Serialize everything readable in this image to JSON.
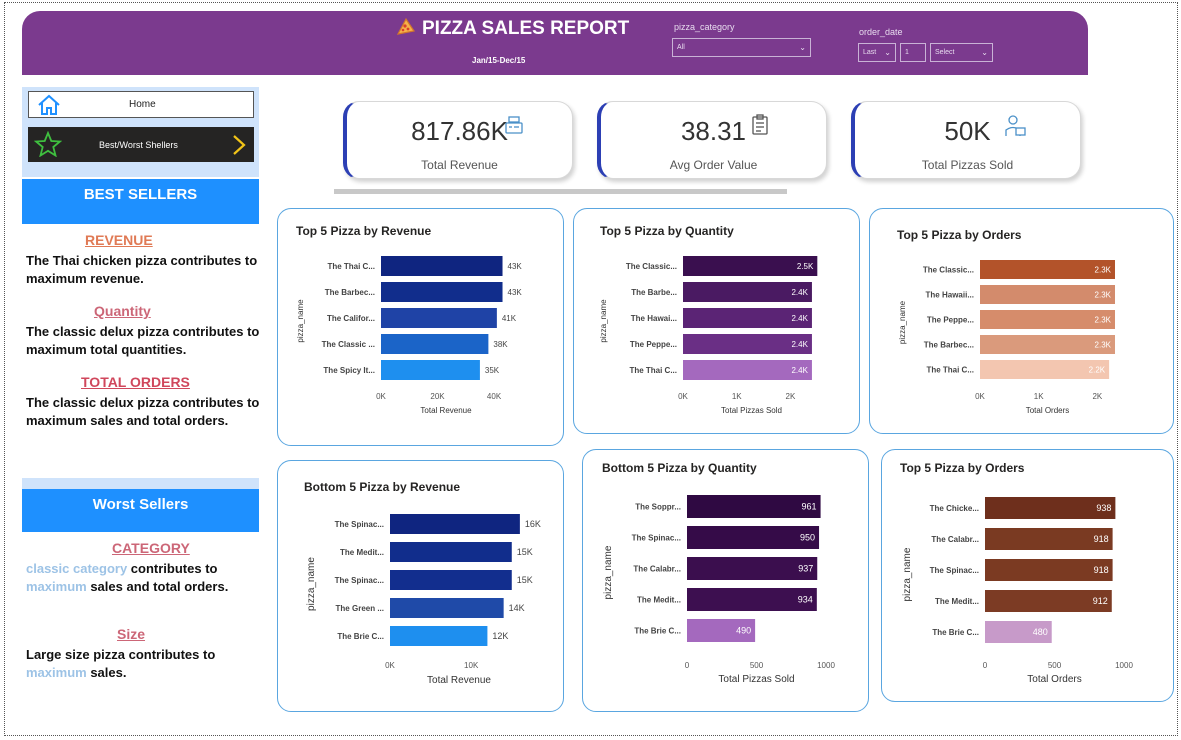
{
  "header": {
    "title": "PIZZA SALES REPORT",
    "subtitle": "Jan/15-Dec/15",
    "filters": {
      "category_label": "pizza_category",
      "category_value": "All",
      "date_label": "order_date",
      "date_mode": "Last",
      "date_count": "1",
      "date_unit": "Select"
    }
  },
  "nav": {
    "home_label": "Home",
    "bestworst_label": "Best/Worst Shellers"
  },
  "best": {
    "heading": "BEST SELLERS",
    "revenue_head": "REVENUE",
    "revenue_text": "The Thai chicken pizza contributes to maximum revenue.",
    "quantity_head": "Quantity",
    "quantity_text": "The classic delux pizza contributes to maximum total quantities.",
    "orders_head": "TOTAL ORDERS",
    "orders_text": "The classic delux pizza contributes to maximum sales and total orders."
  },
  "worst": {
    "heading": "Worst Sellers",
    "category_head": "CATEGORY",
    "category_hl1": "classic category",
    "category_t1": " contributes to",
    "category_hl2": "maximum",
    "category_t2": " sales and total orders.",
    "size_head": "Size",
    "size_t1": "Large size pizza contributes to",
    "size_hl": "maximum",
    "size_t2": " sales."
  },
  "kpis": [
    {
      "value": "817.86K",
      "label": "Total Revenue",
      "icon": "cash-register-icon"
    },
    {
      "value": "38.31",
      "label": "Avg Order Value",
      "icon": "clipboard-icon"
    },
    {
      "value": "50K",
      "label": "Total Pizzas Sold",
      "icon": "delivery-person-icon"
    }
  ],
  "colors": {
    "header": "#7b3a8e",
    "accent_blue": "#1e90ff",
    "kpi_border": "#2c3fb4"
  },
  "chart_data": [
    {
      "id": "top-revenue",
      "type": "bar",
      "title": "Top 5 Pizza by Revenue",
      "ylabel": "pizza_name",
      "xlabel": "Total Revenue",
      "categories": [
        "The Thai C...",
        "The Barbec...",
        "The Califor...",
        "The Classic ...",
        "The Spicy It..."
      ],
      "values": [
        43,
        43,
        41,
        38,
        35
      ],
      "labels": [
        "43K",
        "43K",
        "41K",
        "38K",
        "35K"
      ],
      "ticks": [
        0,
        20,
        40
      ],
      "tick_labels": [
        "0K",
        "20K",
        "40K"
      ],
      "xlim": [
        0,
        46
      ],
      "colors": [
        "#0f2580",
        "#112d8c",
        "#1f43a6",
        "#1b64c8",
        "#1e8fef"
      ]
    },
    {
      "id": "top-quantity",
      "type": "bar",
      "title": "Top 5 Pizza by Quantity",
      "ylabel": "pizza_name",
      "xlabel": "Total Pizzas Sold",
      "categories": [
        "The Classic...",
        "The Barbe...",
        "The Hawai...",
        "The Peppe...",
        "The Thai C..."
      ],
      "values": [
        2.5,
        2.4,
        2.4,
        2.4,
        2.4
      ],
      "labels": [
        "2.5K",
        "2.4K",
        "2.4K",
        "2.4K",
        "2.4K"
      ],
      "ticks": [
        0,
        1,
        2
      ],
      "tick_labels": [
        "0K",
        "1K",
        "2K"
      ],
      "xlim": [
        0,
        2.55
      ],
      "colors": [
        "#3a0f4f",
        "#4a1a62",
        "#5b2475",
        "#6a2f85",
        "#a469be"
      ]
    },
    {
      "id": "top-orders-1",
      "type": "bar",
      "title": "Top 5 Pizza by Orders",
      "ylabel": "pizza_name",
      "xlabel": "Total Orders",
      "categories": [
        "The Classic...",
        "The Hawaii...",
        "The Peppe...",
        "The Barbec...",
        "The Thai C..."
      ],
      "values": [
        2.3,
        2.3,
        2.3,
        2.3,
        2.2
      ],
      "labels": [
        "2.3K",
        "2.3K",
        "2.3K",
        "2.3K",
        "2.2K"
      ],
      "ticks": [
        0,
        1,
        2
      ],
      "tick_labels": [
        "0K",
        "1K",
        "2K"
      ],
      "xlim": [
        0,
        2.3
      ],
      "colors": [
        "#b3532a",
        "#d38b6c",
        "#d68c6b",
        "#da9a7c",
        "#f3c6b0"
      ]
    },
    {
      "id": "bottom-revenue",
      "type": "bar",
      "title": "Bottom 5 Pizza by Revenue",
      "ylabel": "pizza_name",
      "xlabel": "Total Revenue",
      "categories": [
        "The Spinac...",
        "The Medit...",
        "The Spinac...",
        "The Green ...",
        "The Brie C..."
      ],
      "values": [
        16,
        15,
        15,
        14,
        12
      ],
      "labels": [
        "16K",
        "15K",
        "15K",
        "14K",
        "12K"
      ],
      "ticks": [
        0,
        10
      ],
      "tick_labels": [
        "0K",
        "10K"
      ],
      "xlim": [
        0,
        17
      ],
      "colors": [
        "#0f2580",
        "#112d8c",
        "#122e8e",
        "#1f4aa8",
        "#1e8fef"
      ]
    },
    {
      "id": "bottom-quantity",
      "type": "bar",
      "title": "Bottom 5 Pizza by Quantity",
      "ylabel": "pizza_name",
      "xlabel": "Total Pizzas Sold",
      "categories": [
        "The Soppr...",
        "The Spinac...",
        "The Calabr...",
        "The Medit...",
        "The Brie C..."
      ],
      "values": [
        961,
        950,
        937,
        934,
        490
      ],
      "labels": [
        "961",
        "950",
        "937",
        "934",
        "490"
      ],
      "ticks": [
        0,
        500,
        1000
      ],
      "tick_labels": [
        "0",
        "500",
        "1000"
      ],
      "xlim": [
        0,
        1000
      ],
      "colors": [
        "#2f0942",
        "#350b48",
        "#3b0e4e",
        "#3d0f50",
        "#a469be"
      ]
    },
    {
      "id": "top-orders-2",
      "type": "bar",
      "title": "Top 5 Pizza by Orders",
      "ylabel": "pizza_name",
      "xlabel": "Total Orders",
      "categories": [
        "The Chicke...",
        "The Calabr...",
        "The Spinac...",
        "The Medit...",
        "The Brie C..."
      ],
      "values": [
        938,
        918,
        918,
        912,
        480
      ],
      "labels": [
        "938",
        "918",
        "918",
        "912",
        "480"
      ],
      "ticks": [
        0,
        500,
        1000
      ],
      "tick_labels": [
        "0",
        "500",
        "1000"
      ],
      "xlim": [
        0,
        1000
      ],
      "colors": [
        "#6e2f1c",
        "#7a3a22",
        "#7b3a22",
        "#7c3b24",
        "#c79ac9"
      ]
    }
  ]
}
